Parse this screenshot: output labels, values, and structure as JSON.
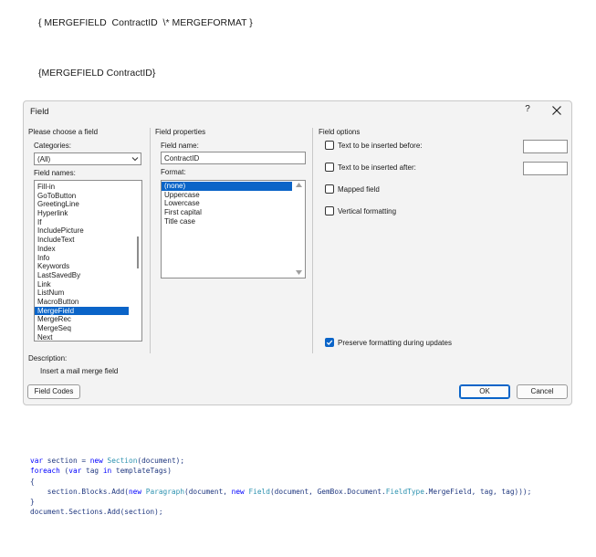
{
  "document": {
    "line1": "{ MERGEFIELD  ContractID  \\* MERGEFORMAT }",
    "line2": "{MERGEFIELD ContractID}"
  },
  "dialog": {
    "title": "Field",
    "help": "?",
    "left_section": "Please choose a field",
    "categories_label": "Categories:",
    "categories_value": "(All)",
    "field_names_label": "Field names:",
    "field_names": [
      "Fill-in",
      "GoToButton",
      "GreetingLine",
      "Hyperlink",
      "If",
      "IncludePicture",
      "IncludeText",
      "Index",
      "Info",
      "Keywords",
      "LastSavedBy",
      "Link",
      "ListNum",
      "MacroButton",
      "MergeField",
      "MergeRec",
      "MergeSeq",
      "Next"
    ],
    "selected_field_name": "MergeField",
    "middle_section": "Field properties",
    "field_name_label": "Field name:",
    "field_name_value": "ContractID",
    "format_label": "Format:",
    "formats": [
      "(none)",
      "Uppercase",
      "Lowercase",
      "First capital",
      "Title case"
    ],
    "selected_format": "(none)",
    "right_section": "Field options",
    "options": {
      "text_before": {
        "label": "Text to be inserted before:",
        "checked": false,
        "value": ""
      },
      "text_after": {
        "label": "Text to be inserted after:",
        "checked": false,
        "value": ""
      },
      "mapped_field": {
        "label": "Mapped field",
        "checked": false
      },
      "vertical_formatting": {
        "label": "Vertical formatting",
        "checked": false
      },
      "preserve_formatting": {
        "label": "Preserve formatting during updates",
        "checked": true
      }
    },
    "description_label": "Description:",
    "description_text": "Insert a mail merge field",
    "field_codes_button": "Field Codes",
    "ok_button": "OK",
    "cancel_button": "Cancel",
    "accent_color": "#0a64c8"
  },
  "code": {
    "lines": [
      [
        [
          "kw",
          "var"
        ],
        [
          "pl",
          " section = "
        ],
        [
          "kw",
          "new"
        ],
        [
          "pl",
          " "
        ],
        [
          "ty",
          "Section"
        ],
        [
          "pl",
          "(document);"
        ]
      ],
      [
        [
          "kw",
          "foreach"
        ],
        [
          "pl",
          " ("
        ],
        [
          "kw",
          "var"
        ],
        [
          "pl",
          " tag "
        ],
        [
          "kw",
          "in"
        ],
        [
          "pl",
          " templateTags)"
        ]
      ],
      [
        [
          "pl",
          "{"
        ]
      ],
      [
        [
          "pl",
          "    section.Blocks.Add("
        ],
        [
          "kw",
          "new"
        ],
        [
          "pl",
          " "
        ],
        [
          "ty",
          "Paragraph"
        ],
        [
          "pl",
          "(document, "
        ],
        [
          "kw",
          "new"
        ],
        [
          "pl",
          " "
        ],
        [
          "ty",
          "Field"
        ],
        [
          "pl",
          "(document, GemBox.Document."
        ],
        [
          "ty",
          "FieldType"
        ],
        [
          "pl",
          ".MergeField, tag, tag)));"
        ]
      ],
      [
        [
          "pl",
          "}"
        ]
      ],
      [
        [
          "pl",
          "document.Sections.Add(section);"
        ]
      ]
    ]
  }
}
